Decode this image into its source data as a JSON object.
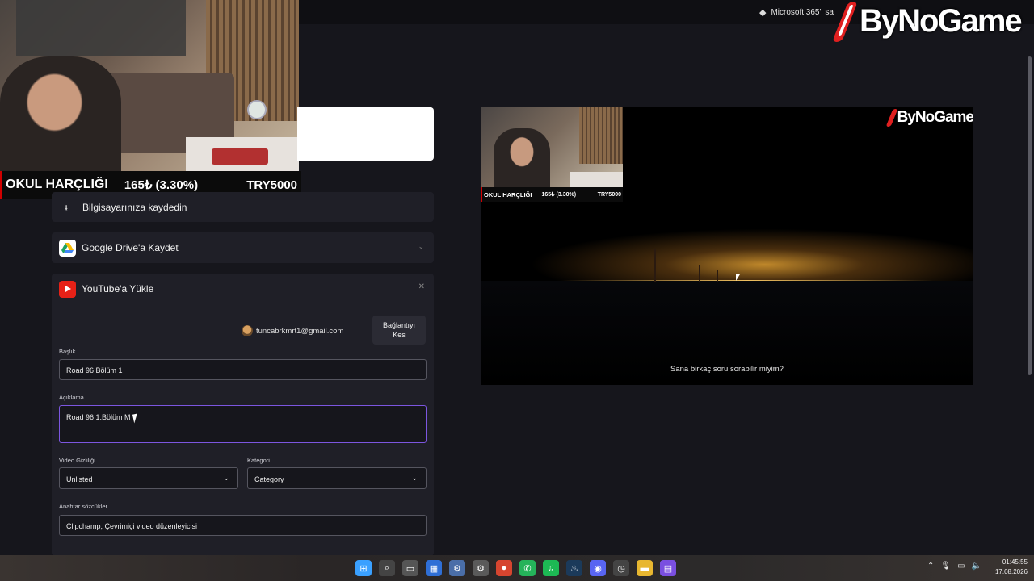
{
  "top_bar": {
    "ms_promo": "Microsoft 365'i sa",
    "brand": "ByNoGame"
  },
  "stream_overlay": {
    "ticker_left": "OKUL HARÇLIĞI",
    "ticker_mid": "165₺ (3.30%)",
    "ticker_right": "TRY5000"
  },
  "export_panel": {
    "download_label": "Bilgisayarınıza kaydedin",
    "gdrive_label": "Google Drive'a Kaydet",
    "youtube_label": "YouTube'a Yükle",
    "account_email": "tuncabrkmrt1@gmail.com",
    "disconnect_line1": "Bağlantıyı",
    "disconnect_line2": "Kes",
    "title_label": "Başlık",
    "title_value": "Road 96 Bölüm 1",
    "description_label": "Açıklama",
    "description_value": "Road 96 1.Bölüm M",
    "visibility_label": "Video Gizliliği",
    "visibility_value": "Unlisted",
    "category_label": "Kategori",
    "category_value": "Category",
    "keywords_label": "Anahtar sözcükler",
    "keywords_value": "Clipchamp, Çevrimiçi video düzenleyicisi"
  },
  "preview": {
    "brand": "ByNoGame",
    "ticker_left": "OKUL HARÇLIĞI",
    "ticker_mid": "165₺ (3.30%)",
    "ticker_right": "TRY5000",
    "subtitle": "Sana birkaç soru sorabilir miyim?"
  },
  "taskbar": {
    "apps": [
      {
        "name": "windows-start-icon",
        "glyph": "⊞",
        "color": "#3aa0ff"
      },
      {
        "name": "search-icon",
        "glyph": "⌕",
        "color": "#444444"
      },
      {
        "name": "task-view-icon",
        "glyph": "▭",
        "color": "#555555"
      },
      {
        "name": "store-icon",
        "glyph": "▦",
        "color": "#2f6fd6"
      },
      {
        "name": "settings-gear-icon",
        "glyph": "⚙",
        "color": "#4a6ea8"
      },
      {
        "name": "settings-alt-icon",
        "glyph": "⚙",
        "color": "#5a5a5a"
      },
      {
        "name": "chrome-icon",
        "glyph": "●",
        "color": "#d6452f"
      },
      {
        "name": "whatsapp-icon",
        "glyph": "✆",
        "color": "#25b35a"
      },
      {
        "name": "spotify-icon",
        "glyph": "♫",
        "color": "#1db954"
      },
      {
        "name": "steam-icon",
        "glyph": "♨",
        "color": "#1b3a5a"
      },
      {
        "name": "discord-icon",
        "glyph": "◉",
        "color": "#5865f2"
      },
      {
        "name": "clock-app-icon",
        "glyph": "◷",
        "color": "#444444"
      },
      {
        "name": "file-explorer-icon",
        "glyph": "▬",
        "color": "#e8b730"
      },
      {
        "name": "clipchamp-icon",
        "glyph": "▤",
        "color": "#7a4fe0"
      }
    ],
    "time": "01:45:55",
    "date": "17.08.2026"
  }
}
